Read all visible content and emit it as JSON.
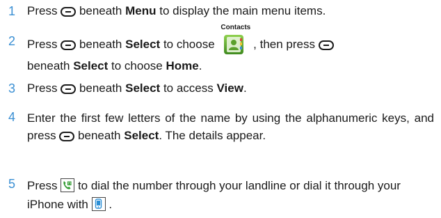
{
  "steps": [
    {
      "number": "1",
      "parts": {
        "a": "Press",
        "b": "beneath",
        "c": "Menu",
        "d": "to display the main menu items."
      }
    },
    {
      "number": "2",
      "parts": {
        "a": "Press",
        "b": "beneath",
        "c": "Select",
        "d": "to choose",
        "icon_caption": "Contacts",
        "e": ", then press",
        "f": "beneath",
        "g": "Select",
        "h": "to choose",
        "i": "Home",
        "j": "."
      }
    },
    {
      "number": "3",
      "parts": {
        "a": "Press",
        "b": "beneath",
        "c": "Select",
        "d": "to access",
        "e": "View",
        "f": "."
      }
    },
    {
      "number": "4",
      "parts": {
        "a": "Enter the first few letters of the name by using the alphanumeric keys, and press",
        "b": "beneath",
        "c": "Select",
        "d": ". The details appear."
      }
    },
    {
      "number": "5",
      "parts": {
        "a": "Press",
        "b": "to dial the number through your landline or dial it through your iPhone with",
        "c": "."
      }
    }
  ],
  "colors": {
    "step_number": "#3a8fd3",
    "text": "#1a1a1a",
    "contacts_icon_green": "#5aa02c",
    "phone_icon_green": "#2f9a2f",
    "mobile_icon_blue": "#2c8fd6"
  },
  "icons": {
    "softkey": "softkey-button-icon",
    "contacts": "contacts-icon",
    "landline": "landline-phone-icon",
    "mobile": "mobile-phone-icon"
  }
}
